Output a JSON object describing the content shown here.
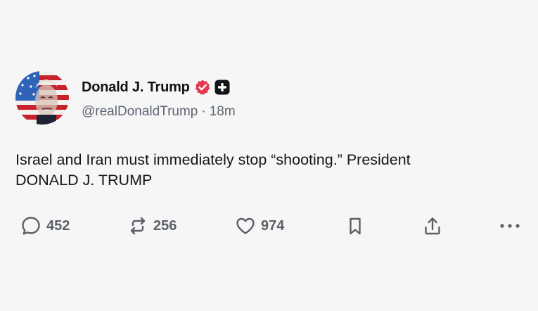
{
  "post": {
    "display_name": "Donald J. Trump",
    "handle": "@realDonaldTrump",
    "separator": "·",
    "time_ago": "18m",
    "text_line1": "Israel and Iran must immediately stop “shooting.” President",
    "text_line2": "DONALD J. TRUMP"
  },
  "actions": {
    "replies": "452",
    "reposts": "256",
    "likes": "974"
  },
  "icons": {
    "verified": "verified-badge-icon",
    "plus": "plus-badge-icon",
    "reply": "speech-bubble-icon",
    "repost": "repost-arrows-icon",
    "like": "heart-icon",
    "bookmark": "bookmark-icon",
    "share": "share-upload-icon",
    "more": "more-dots-icon"
  },
  "colors": {
    "background": "#f6f6f7",
    "verified_badge": "#e53950",
    "text_primary": "#121212",
    "text_secondary": "#5f6670"
  }
}
